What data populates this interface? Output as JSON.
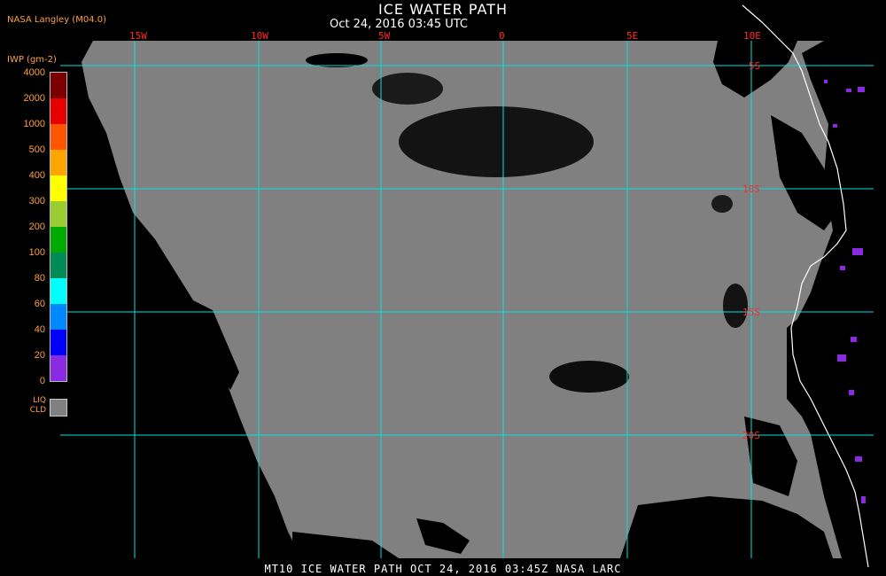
{
  "header": {
    "title": "ICE WATER PATH",
    "subtitle": "Oct 24, 2016 03:45 UTC",
    "source": "NASA Langley (M04.0)"
  },
  "legend": {
    "title": "IWP (gm-2)",
    "labels": [
      "4000",
      "2000",
      "1000",
      "500",
      "400",
      "300",
      "200",
      "100",
      "80",
      "60",
      "40",
      "20",
      "0"
    ],
    "colors": [
      "#7a0000",
      "#e60000",
      "#ff5500",
      "#ffa500",
      "#ffff00",
      "#9acd32",
      "#00aa00",
      "#008a55",
      "#00ffff",
      "#0088ff",
      "#0000ff",
      "#8a2be2"
    ],
    "liquid_label_line1": "LIQ",
    "liquid_label_line2": "CLD",
    "liquid_color": "#808080"
  },
  "map": {
    "lon_labels": [
      "15W",
      "10W",
      "5W",
      "0",
      "5E",
      "10E"
    ],
    "lat_labels": [
      "5S",
      "10S",
      "15S",
      "20S"
    ],
    "ocean_cloud_color": "#808080",
    "clear_color": "#000000",
    "grid_color": "#00e0e0",
    "label_color": "#ff2a2a",
    "coast_color": "#ffffff"
  },
  "footer": {
    "text": "MT10  ICE WATER PATH   OCT 24, 2016 03:45Z   NASA LARC"
  }
}
